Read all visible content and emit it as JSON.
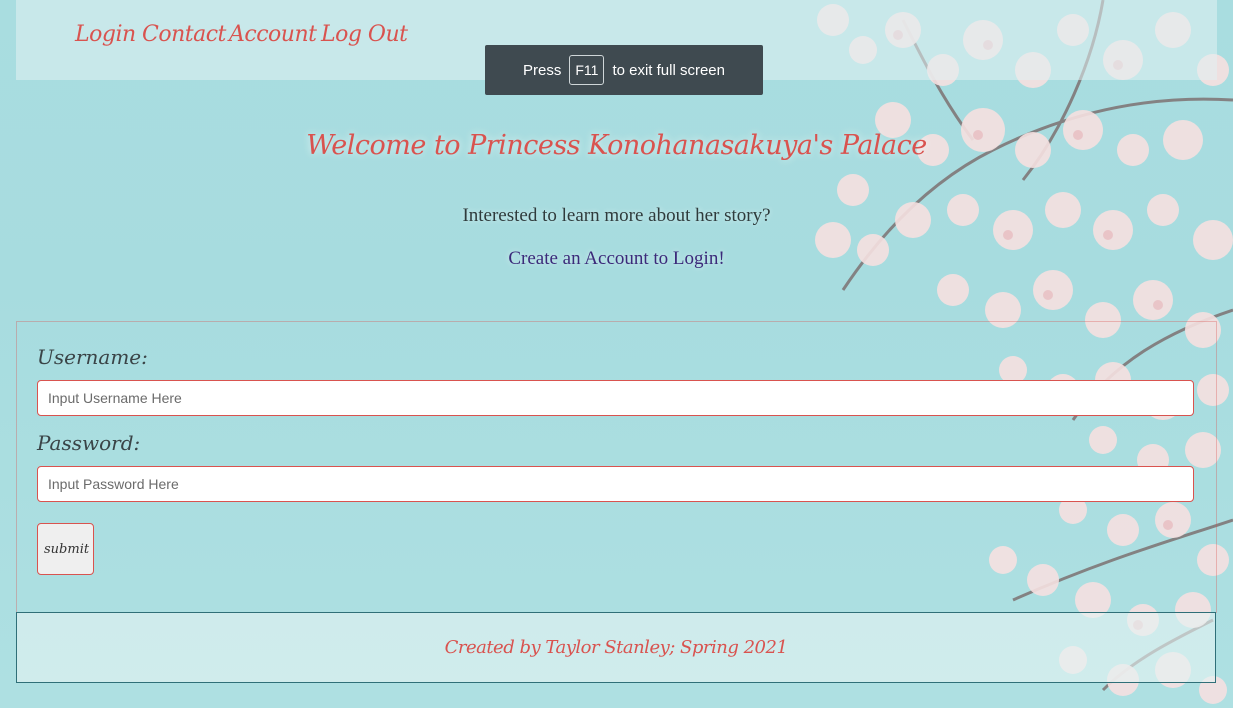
{
  "nav": {
    "items": [
      {
        "label": "Login"
      },
      {
        "label": "Contact"
      },
      {
        "label": "Account"
      },
      {
        "label": "Log Out"
      }
    ]
  },
  "fullscreen_toast": {
    "press": "Press",
    "key": "F11",
    "suffix": "to exit full screen"
  },
  "main": {
    "title": "Welcome to Princess Konohanasakuya's Palace",
    "subtitle": "Interested to learn more about her story?",
    "create_link": "Create an Account to Login!"
  },
  "form": {
    "username_label": "Username:",
    "username_placeholder": "Input Username Here",
    "password_label": "Password:",
    "password_placeholder": "Input Password Here",
    "submit_label": "submit"
  },
  "footer": {
    "text": "Created by Taylor Stanley; Spring 2021"
  },
  "colors": {
    "accent": "#d9534f",
    "background": "#a9dde0",
    "toast": "#3f4a50",
    "link": "#3b2a7a"
  }
}
